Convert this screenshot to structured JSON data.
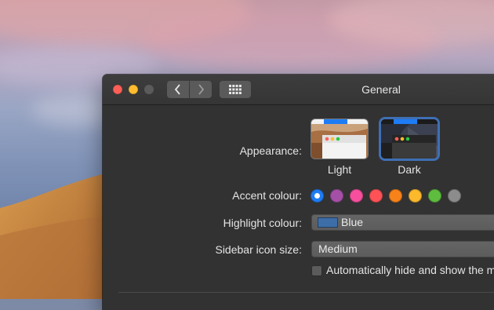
{
  "window": {
    "title": "General",
    "nav_back_glyph": "‹",
    "nav_forward_glyph": "›"
  },
  "appearance": {
    "label": "Appearance:",
    "options": [
      {
        "name": "Light",
        "selected": false
      },
      {
        "name": "Dark",
        "selected": true
      }
    ]
  },
  "accent": {
    "label": "Accent colour:",
    "selected_index": 0,
    "colors": [
      "#1e7cf5",
      "#a550a7",
      "#f74f9e",
      "#ff5257",
      "#f8821a",
      "#fdb92c",
      "#5ebd3e",
      "#8c8c8c"
    ]
  },
  "highlight": {
    "label": "Highlight colour:",
    "value": "Blue",
    "swatch_color": "#3e6ea8"
  },
  "sidebar_icon_size": {
    "label": "Sidebar icon size:",
    "value": "Medium"
  },
  "auto_hide": {
    "label": "Automatically hide and show the m",
    "checked": false
  },
  "icons": {
    "close": "close-icon",
    "minimize": "minimize-icon",
    "zoom": "zoom-icon",
    "back": "chevron-left-icon",
    "forward": "chevron-right-icon",
    "grid": "grid-icon"
  }
}
